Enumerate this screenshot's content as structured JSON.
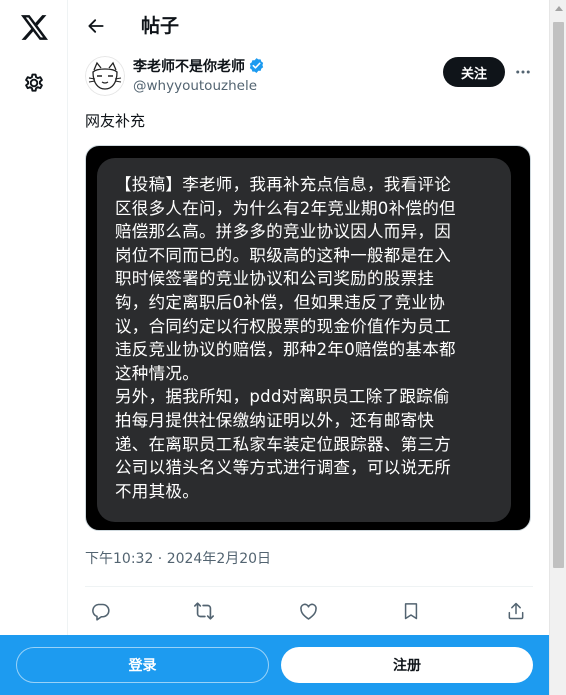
{
  "header": {
    "title": "帖子"
  },
  "nav": {
    "logo_icon": "x-logo-icon",
    "settings_icon": "gear-icon",
    "back_icon": "arrow-left-icon"
  },
  "post": {
    "author": {
      "name": "李老师不是你老师",
      "handle": "@whyyoutouzhele",
      "verified": true
    },
    "follow_label": "关注",
    "text": "网友补充",
    "image_text": "【投稿】李老师，我再补充点信息，我看评论\n区很多人在问，为什么有2年竞业期0补偿的但\n赔偿那么高。拼多多的竞业协议因人而异，因\n岗位不同而已的。职级高的这种一般都是在入\n职时候签署的竞业协议和公司奖励的股票挂\n钩，约定离职后0补偿，但如果违反了竞业协\n议，合同约定以行权股票的现金价值作为员工\n违反竞业协议的赔偿，那种2年0赔偿的基本都\n这种情况。\n另外，据我所知，pdd对离职员工除了跟踪偷\n拍每月提供社保缴纳证明以外，还有邮寄快\n递、在离职员工私家车装定位跟踪器、第三方\n公司以猎头名义等方式进行调查，可以说无所\n不用其极。",
    "timestamp": "下午10:32 · 2024年2月20日"
  },
  "actions": [
    "reply-icon",
    "retweet-icon",
    "like-icon",
    "bookmark-icon",
    "share-icon"
  ],
  "bottom_bar": {
    "login_label": "登录",
    "register_label": "注册"
  },
  "colors": {
    "accent": "#1d9bf0",
    "text": "#0f1419",
    "muted": "#536471",
    "verified": "#1d9bf0"
  }
}
